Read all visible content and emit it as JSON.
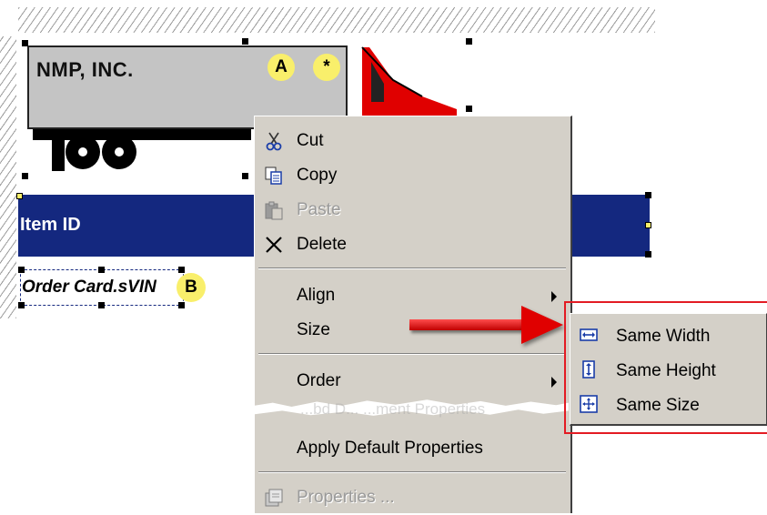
{
  "canvas": {
    "trailer_text": "NMP, INC.",
    "band_text": "Item ID",
    "order_field_text": "Order Card.sVIN",
    "callout_a": "A",
    "callout_star": "*",
    "callout_b": "B"
  },
  "context_menu": {
    "items": [
      {
        "label": "Cut",
        "icon": "scissors-icon",
        "enabled": true
      },
      {
        "label": "Copy",
        "icon": "copy-icon",
        "enabled": true
      },
      {
        "label": "Paste",
        "icon": "paste-icon",
        "enabled": false
      },
      {
        "label": "Delete",
        "icon": "delete-x-icon",
        "enabled": true
      },
      {
        "label": "Align",
        "has_submenu": true
      },
      {
        "label": "Size",
        "has_submenu": true
      },
      {
        "label": "Order",
        "has_submenu": true
      },
      {
        "label": "Apply Default Properties",
        "enabled": true
      },
      {
        "label": "Properties ...",
        "icon": "properties-icon",
        "enabled": false
      }
    ],
    "torn_text": "...bd D... ...ment Properties"
  },
  "size_submenu": {
    "items": [
      {
        "label": "Same Width",
        "icon": "same-width-icon"
      },
      {
        "label": "Same Height",
        "icon": "same-height-icon"
      },
      {
        "label": "Same Size",
        "icon": "same-size-icon"
      }
    ]
  },
  "colors": {
    "band": "#14287f",
    "menu_bg": "#d4d0c8",
    "highlight": "#e31b23",
    "callout": "#f9ef6b",
    "truck_cab": "#e00000"
  }
}
